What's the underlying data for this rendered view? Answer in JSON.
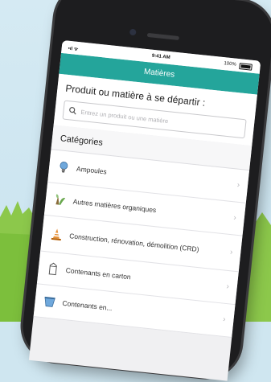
{
  "status_bar": {
    "signal": "•ıl ᯤ",
    "time": "9:41 AM",
    "battery": "100%"
  },
  "nav": {
    "title": "Matières"
  },
  "search": {
    "heading": "Produit ou matière à se départir :",
    "placeholder": "Entrez un produit ou une matière"
  },
  "categories": {
    "title": "Catégories",
    "items": [
      {
        "label": "Ampoules",
        "icon": "lightbulb-icon"
      },
      {
        "label": "Autres matières organiques",
        "icon": "organic-matter-icon"
      },
      {
        "label": "Construction, rénovation, démolition (CRD)",
        "icon": "traffic-cone-icon"
      },
      {
        "label": "Contenants en carton",
        "icon": "carton-container-icon"
      },
      {
        "label": "Contenants en...",
        "icon": "container-icon"
      }
    ]
  },
  "colors": {
    "accent": "#24a59b",
    "sky": "#cfe6f0",
    "grass": "#7cbf3c"
  }
}
